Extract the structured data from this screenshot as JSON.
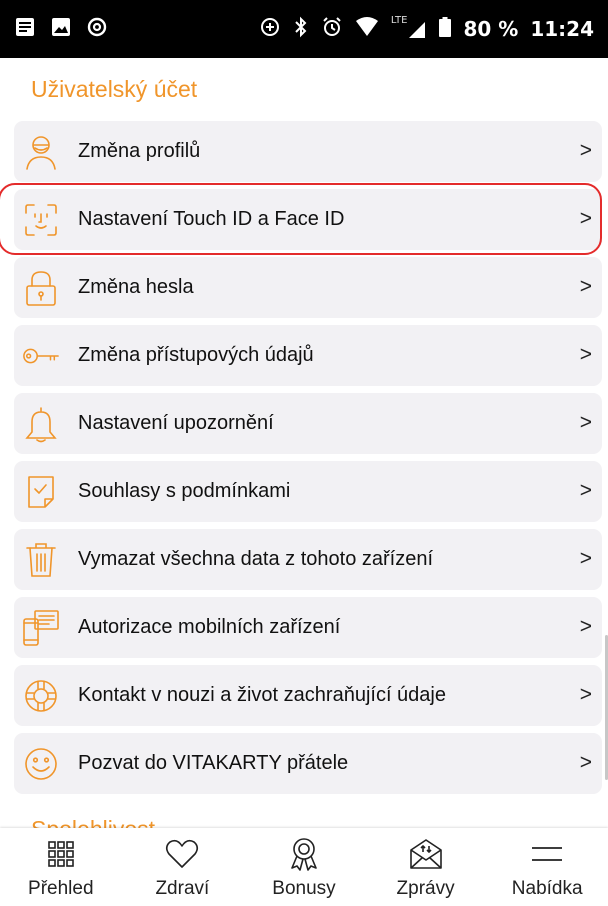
{
  "status_bar": {
    "left_icons": [
      "notes-icon",
      "image-icon",
      "at-icon"
    ],
    "right_icons": [
      "data-saver-icon",
      "bluetooth-icon",
      "alarm-icon",
      "wifi-icon",
      "lte-signal-icon",
      "battery-icon"
    ],
    "lte": "LTE",
    "battery_percent": "80 %",
    "time": "11:24"
  },
  "section": {
    "title": "Uživatelský účet"
  },
  "items": [
    {
      "label": "Změna profilů",
      "icon": "profile-icon"
    },
    {
      "label": "Nastavení Touch ID a Face ID",
      "icon": "face-id-icon"
    },
    {
      "label": "Změna hesla",
      "icon": "lock-icon"
    },
    {
      "label": "Změna přístupových údajů",
      "icon": "key-icon"
    },
    {
      "label": "Nastavení upozornění",
      "icon": "bell-icon"
    },
    {
      "label": "Souhlasy s podmínkami",
      "icon": "document-check-icon"
    },
    {
      "label": "Vymazat všechna data z tohoto zařízení",
      "icon": "trash-icon"
    },
    {
      "label": "Autorizace mobilních zařízení",
      "icon": "devices-icon"
    },
    {
      "label": "Kontakt v nouzi a život zachraňující údaje",
      "icon": "lifebuoy-icon"
    },
    {
      "label": "Pozvat do VITAKARTY přátele",
      "icon": "smiley-icon"
    }
  ],
  "chevron": ">",
  "next_section_title": "Spolehlivost",
  "bottom_nav": [
    {
      "label": "Přehled",
      "icon": "grid-icon"
    },
    {
      "label": "Zdraví",
      "icon": "heart-icon"
    },
    {
      "label": "Bonusy",
      "icon": "award-icon"
    },
    {
      "label": "Zprávy",
      "icon": "envelope-icon"
    },
    {
      "label": "Nabídka",
      "icon": "menu-icon"
    }
  ],
  "colors": {
    "accent": "#f0952a",
    "highlight": "#e42b2b",
    "item_bg": "#f2f1f4"
  }
}
